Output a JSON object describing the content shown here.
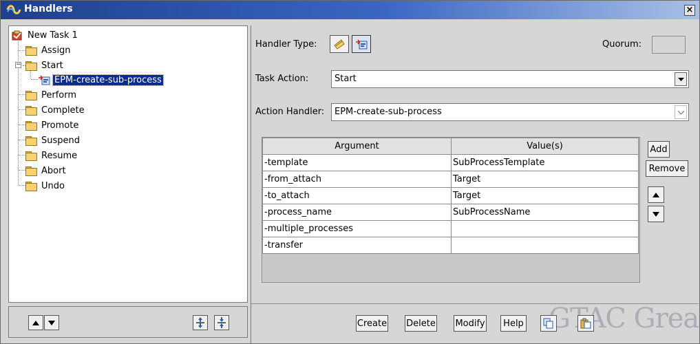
{
  "window": {
    "title": "Handlers",
    "close_glyph": "×"
  },
  "tree": {
    "root": {
      "label": "New Task 1",
      "icon": "task-icon"
    },
    "items": [
      {
        "label": "Assign",
        "icon": "folder-icon"
      },
      {
        "label": "Start",
        "icon": "folder-icon",
        "expanded": true
      },
      {
        "label": "EPM-create-sub-process",
        "icon": "handler-icon",
        "selected": true
      },
      {
        "label": "Perform",
        "icon": "folder-icon"
      },
      {
        "label": "Complete",
        "icon": "folder-icon"
      },
      {
        "label": "Promote",
        "icon": "folder-icon"
      },
      {
        "label": "Suspend",
        "icon": "folder-icon"
      },
      {
        "label": "Resume",
        "icon": "folder-icon"
      },
      {
        "label": "Abort",
        "icon": "folder-icon"
      },
      {
        "label": "Undo",
        "icon": "folder-icon"
      }
    ],
    "expander_glyph": "−"
  },
  "form": {
    "handler_type_label": "Handler Type:",
    "quorum_label": "Quorum:",
    "quorum_value": "",
    "task_action_label": "Task Action:",
    "task_action_value": "Start",
    "action_handler_label": "Action Handler:",
    "action_handler_value": "EPM-create-sub-process"
  },
  "table": {
    "headers": [
      "Argument",
      "Value(s)"
    ],
    "rows": [
      [
        "-template",
        "SubProcessTemplate"
      ],
      [
        "-from_attach",
        "Target"
      ],
      [
        "-to_attach",
        "Target"
      ],
      [
        "-process_name",
        "SubProcessName"
      ],
      [
        "-multiple_processes",
        ""
      ],
      [
        "-transfer",
        ""
      ]
    ]
  },
  "side_buttons": {
    "add": "Add",
    "remove": "Remove"
  },
  "bottom_buttons": {
    "create": "Create",
    "delete": "Delete",
    "modify": "Modify",
    "help": "Help"
  },
  "watermark": "GTAC Great",
  "colors": {
    "titlebar": "#1e3f8c",
    "selection": "#0a2c8c",
    "panel": "#d6d6d6"
  }
}
